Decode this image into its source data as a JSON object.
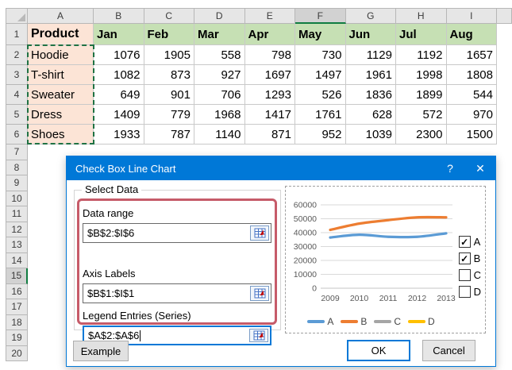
{
  "sheet": {
    "col_headers": [
      "A",
      "B",
      "C",
      "D",
      "E",
      "F",
      "G",
      "H",
      "I"
    ],
    "active_col": "F",
    "row_headers": [
      "1",
      "2",
      "3",
      "4",
      "5",
      "6",
      "7",
      "8",
      "9",
      "10",
      "11",
      "12",
      "13",
      "14",
      "15",
      "16",
      "17",
      "18",
      "19",
      "20"
    ],
    "active_row": "15",
    "header_row": {
      "product_label": "Product",
      "months": [
        "Jan",
        "Feb",
        "Mar",
        "Apr",
        "May",
        "Jun",
        "Jul",
        "Aug"
      ]
    },
    "rows": [
      {
        "name": "Hoodie",
        "values": [
          1076,
          1905,
          558,
          798,
          730,
          1129,
          1192,
          1657
        ]
      },
      {
        "name": "T-shirt",
        "values": [
          1082,
          873,
          927,
          1697,
          1497,
          1961,
          1998,
          1808
        ]
      },
      {
        "name": "Sweater",
        "values": [
          649,
          901,
          706,
          1293,
          526,
          1836,
          1899,
          544
        ]
      },
      {
        "name": "Dress",
        "values": [
          1409,
          779,
          1968,
          1417,
          1761,
          628,
          572,
          970
        ]
      },
      {
        "name": "Shoes",
        "values": [
          1933,
          787,
          1140,
          871,
          952,
          1039,
          2300,
          1500
        ]
      }
    ],
    "selection_range": "A2:A6"
  },
  "dialog": {
    "title": "Check Box Line Chart",
    "help_label": "?",
    "close_label": "✕",
    "group_label": "Select Data",
    "fields": [
      {
        "label": "Data range",
        "value": "$B$2:$I$6",
        "focused": false
      },
      {
        "label": "Axis Labels",
        "value": "$B$1:$I$1",
        "focused": false
      },
      {
        "label": "Legend Entries (Series)",
        "value": "$A$2:$A$6",
        "focused": true
      }
    ],
    "checkboxes": [
      {
        "label": "A",
        "checked": true
      },
      {
        "label": "B",
        "checked": true
      },
      {
        "label": "C",
        "checked": false
      },
      {
        "label": "D",
        "checked": false
      }
    ],
    "example_button": "Example",
    "ok_button": "OK",
    "cancel_button": "Cancel"
  },
  "chart_data": {
    "type": "line",
    "x": [
      "2009",
      "2010",
      "2011",
      "2012",
      "2013"
    ],
    "series": [
      {
        "name": "A",
        "color": "#5B9BD5",
        "visible": true,
        "values": [
          36500,
          38500,
          37000,
          37000,
          39500
        ]
      },
      {
        "name": "B",
        "color": "#ED7D31",
        "visible": true,
        "values": [
          42000,
          46500,
          49000,
          51000,
          51000
        ]
      },
      {
        "name": "C",
        "color": "#A5A5A5",
        "visible": false,
        "values": []
      },
      {
        "name": "D",
        "color": "#FFC000",
        "visible": false,
        "values": []
      }
    ],
    "ylim": [
      0,
      60000
    ],
    "yticks": [
      0,
      10000,
      20000,
      30000,
      40000,
      50000,
      60000
    ],
    "grid": true,
    "legend_position": "bottom",
    "title": "",
    "xlabel": "",
    "ylabel": ""
  },
  "colors": {
    "titlebar_blue": "#0078D7",
    "excel_green": "#107C41",
    "ants_green": "#1F7244",
    "annotation_red": "#C65B69",
    "peach_fill": "#FCE4D6",
    "green_fill": "#C6E0B4",
    "header_gray": "#E6E6E6"
  }
}
